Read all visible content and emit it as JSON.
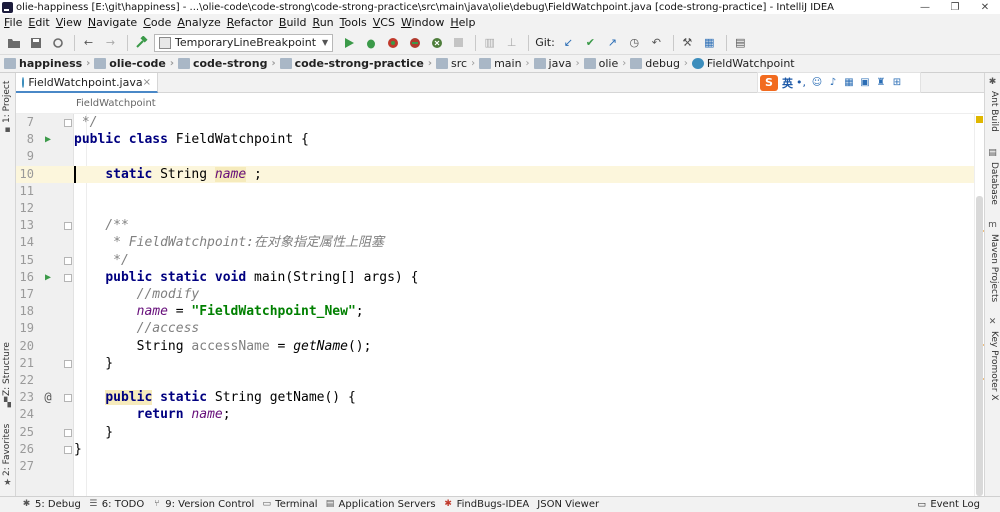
{
  "window": {
    "title": "olie-happiness [E:\\git\\happiness] - ...\\olie-code\\code-strong\\code-strong-practice\\src\\main\\java\\olie\\debug\\FieldWatchpoint.java [code-strong-practice] - IntelliJ IDEA",
    "minimize": "—",
    "maximize": "❐",
    "close": "✕"
  },
  "menu": [
    "File",
    "Edit",
    "View",
    "Navigate",
    "Code",
    "Analyze",
    "Refactor",
    "Build",
    "Run",
    "Tools",
    "VCS",
    "Window",
    "Help"
  ],
  "toolbar": {
    "run_config": "TemporaryLineBreakpoint",
    "git_label": "Git:"
  },
  "breadcrumbs": [
    "happiness",
    "olie-code",
    "code-strong",
    "code-strong-practice",
    "src",
    "main",
    "java",
    "olie",
    "debug",
    "FieldWatchpoint"
  ],
  "editor_tab": {
    "label": "FieldWatchpoint.java",
    "close": "×"
  },
  "ime": {
    "logo": "S",
    "mode": "英",
    "punct": "•,"
  },
  "structure_crumb": "FieldWatchpoint",
  "left_tools": {
    "project": "1: Project",
    "structure": "Z: Structure",
    "favorites": "2: Favorites"
  },
  "right_tools": {
    "ant": "Ant Build",
    "database": "Database",
    "maven": "Maven Projects",
    "key": "Key Promoter X"
  },
  "code": {
    "lines": [
      {
        "n": "7",
        "type": "plain",
        "t": " */",
        "cls": "cm",
        "run": false,
        "at": false,
        "fold": true
      },
      {
        "n": "8",
        "type": "class",
        "run": true,
        "at": false,
        "fold": false
      },
      {
        "n": "9",
        "type": "empty",
        "run": false,
        "at": false,
        "fold": false
      },
      {
        "n": "10",
        "type": "field",
        "run": false,
        "at": false,
        "fold": false
      },
      {
        "n": "11",
        "type": "empty",
        "run": false,
        "at": false,
        "fold": false
      },
      {
        "n": "12",
        "type": "empty",
        "run": false,
        "at": false,
        "fold": false
      },
      {
        "n": "13",
        "type": "plain",
        "t": "    /**",
        "cls": "cm",
        "run": false,
        "at": false,
        "fold": true
      },
      {
        "n": "14",
        "type": "plain",
        "t": "     * FieldWatchpoint:在对象指定属性上阻塞",
        "cls": "cm",
        "run": false,
        "at": false,
        "fold": false
      },
      {
        "n": "15",
        "type": "plain",
        "t": "     */",
        "cls": "cm",
        "run": false,
        "at": false,
        "fold": true
      },
      {
        "n": "16",
        "type": "main",
        "run": true,
        "at": false,
        "fold": true
      },
      {
        "n": "17",
        "type": "plain",
        "t": "        //modify",
        "cls": "cm",
        "run": false,
        "at": false,
        "fold": false
      },
      {
        "n": "18",
        "type": "assign",
        "run": false,
        "at": false,
        "fold": false
      },
      {
        "n": "19",
        "type": "plain",
        "t": "        //access",
        "cls": "cm",
        "run": false,
        "at": false,
        "fold": false
      },
      {
        "n": "20",
        "type": "local",
        "run": false,
        "at": false,
        "fold": false
      },
      {
        "n": "21",
        "type": "plain",
        "t": "    }",
        "cls": "",
        "run": false,
        "at": false,
        "fold": true
      },
      {
        "n": "22",
        "type": "empty",
        "run": false,
        "at": false,
        "fold": false
      },
      {
        "n": "23",
        "type": "getter",
        "run": false,
        "at": true,
        "fold": true
      },
      {
        "n": "24",
        "type": "return",
        "run": false,
        "at": false,
        "fold": false
      },
      {
        "n": "25",
        "type": "plain",
        "t": "    }",
        "cls": "",
        "run": false,
        "at": false,
        "fold": true
      },
      {
        "n": "26",
        "type": "plain",
        "t": "}",
        "cls": "",
        "run": false,
        "at": false,
        "fold": true
      },
      {
        "n": "27",
        "type": "empty",
        "run": false,
        "at": false,
        "fold": false
      }
    ],
    "class_line": {
      "kw": "public class",
      "rest": " FieldWatchpoint {"
    },
    "field_line": {
      "kw": "static",
      "type": " String ",
      "name": "name",
      "rest": " ;"
    },
    "main_line": {
      "kw": "public static void",
      "rest": " main(String[] args) {"
    },
    "assign_line": {
      "name": "name",
      "eq": " = ",
      "str": "\"FieldWatchpoint_New\"",
      "end": ";"
    },
    "local_line": {
      "type": "String ",
      "var": "accessName",
      "eq": " = ",
      "call": "getName",
      "end": "();"
    },
    "getter_line": {
      "kw1": "public",
      "kw2": " static",
      "rest": " String getName() {"
    },
    "return_line": {
      "kw": "return",
      "name": "name",
      "end": ";"
    }
  },
  "status": {
    "items": [
      {
        "icon": "✱",
        "label": "5: Debug"
      },
      {
        "icon": "☰",
        "label": "6: TODO"
      },
      {
        "icon": "⑂",
        "label": "9: Version Control"
      },
      {
        "icon": "▭",
        "label": "Terminal"
      },
      {
        "icon": "▤",
        "label": "Application Servers"
      },
      {
        "icon": "✱",
        "label": "FindBugs-IDEA"
      },
      {
        "icon": "",
        "label": "JSON Viewer"
      }
    ],
    "event_log": "Event Log"
  },
  "colors": {
    "keyword": "#000080",
    "comment": "#808080",
    "string": "#008000",
    "field": "#660e7a",
    "current_line": "#fcf6dc",
    "run_icon": "#3b9a49"
  }
}
